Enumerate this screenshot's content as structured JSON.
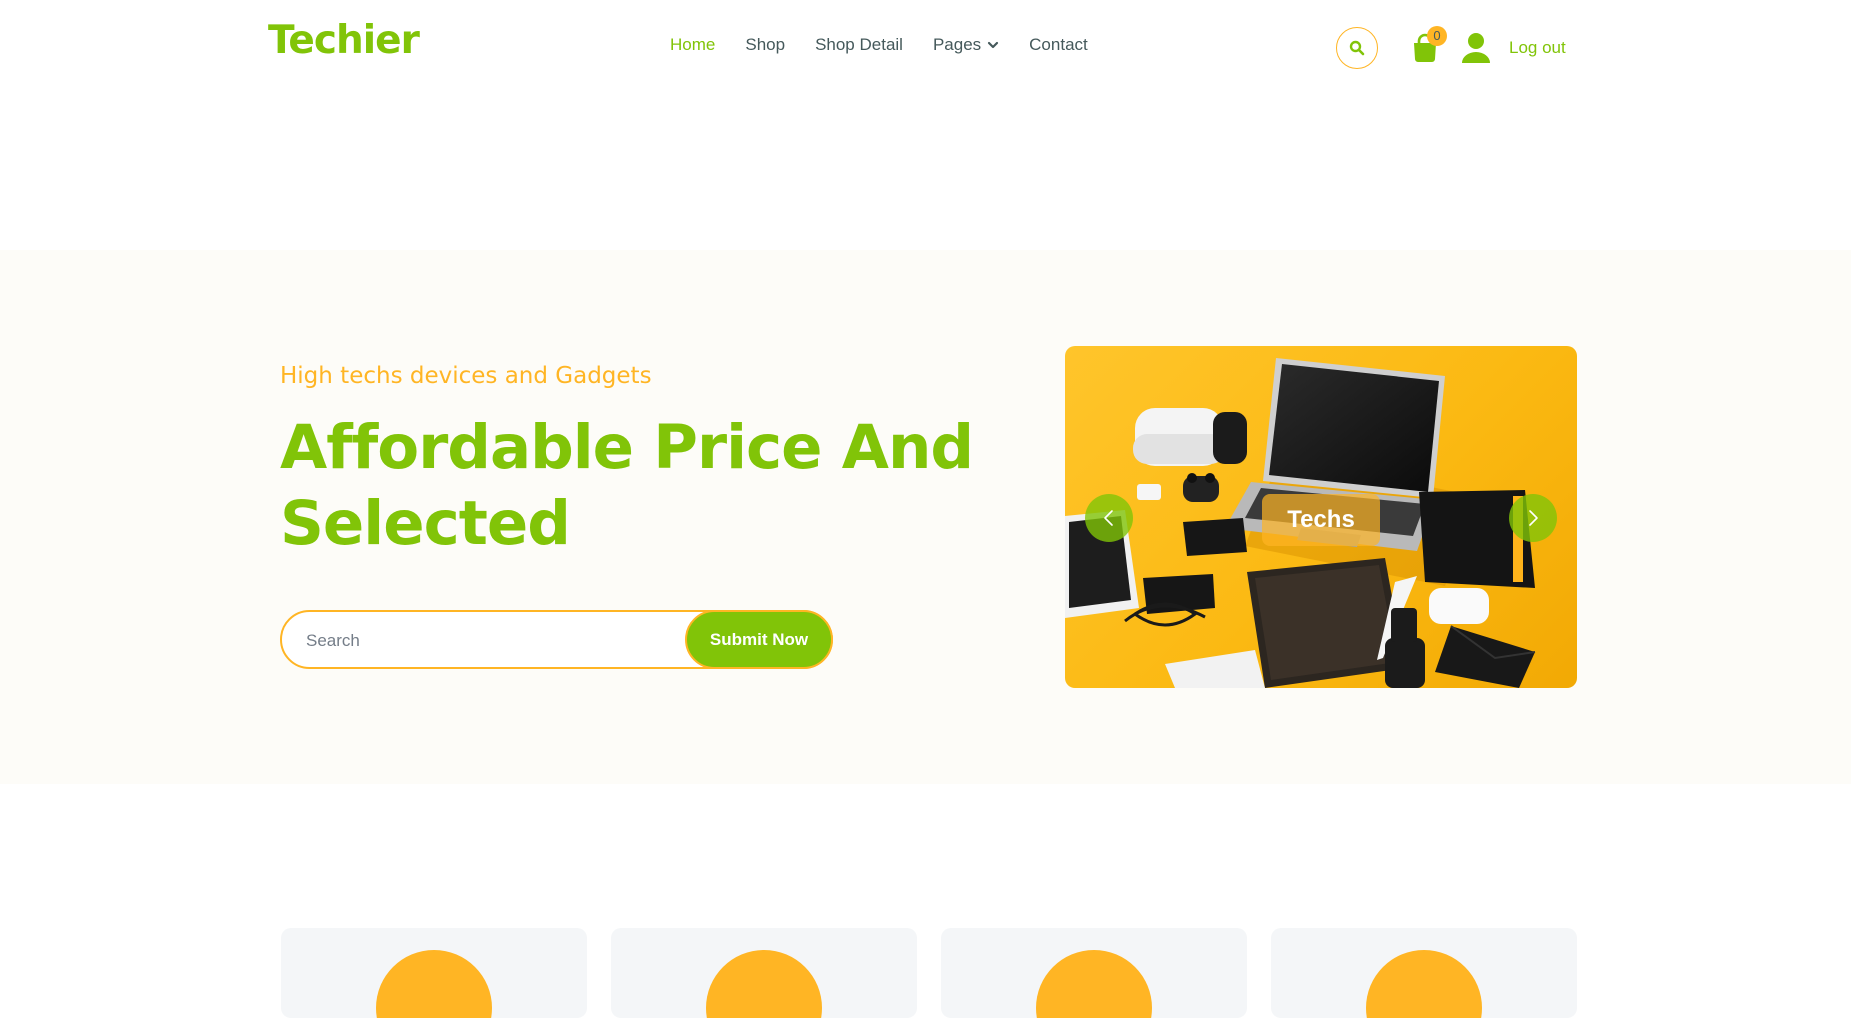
{
  "brand": {
    "name": "Techier",
    "color": "#81c408"
  },
  "nav": {
    "links": [
      {
        "label": "Home",
        "active": true
      },
      {
        "label": "Shop",
        "active": false
      },
      {
        "label": "Shop Detail",
        "active": false
      },
      {
        "label": "Pages",
        "active": false,
        "dropdown": true
      },
      {
        "label": "Contact",
        "active": false
      }
    ],
    "icons": {
      "search": "search-icon",
      "cart": "shopping-bag-icon",
      "user": "user-icon",
      "dropdown": "chevron-down-icon"
    },
    "cart_count": "0",
    "logout_label": "Log out"
  },
  "hero": {
    "eyebrow": "High techs devices and Gadgets",
    "headline": "Affordable Price And Selected",
    "search": {
      "placeholder": "Search",
      "value": "",
      "button_label": "Submit Now"
    },
    "carousel": {
      "caption": "Techs",
      "prev_icon": "chevron-left-icon",
      "next_icon": "chevron-right-icon"
    }
  },
  "features": {
    "cards": [
      {
        "icon": "feature-icon"
      },
      {
        "icon": "feature-icon"
      },
      {
        "icon": "feature-icon"
      },
      {
        "icon": "feature-icon"
      }
    ]
  },
  "colors": {
    "primary": "#81c408",
    "secondary": "#ffb524",
    "text": "#45595b",
    "hero_bg": "#fdfcf8",
    "card_bg": "#f4f6f8"
  }
}
